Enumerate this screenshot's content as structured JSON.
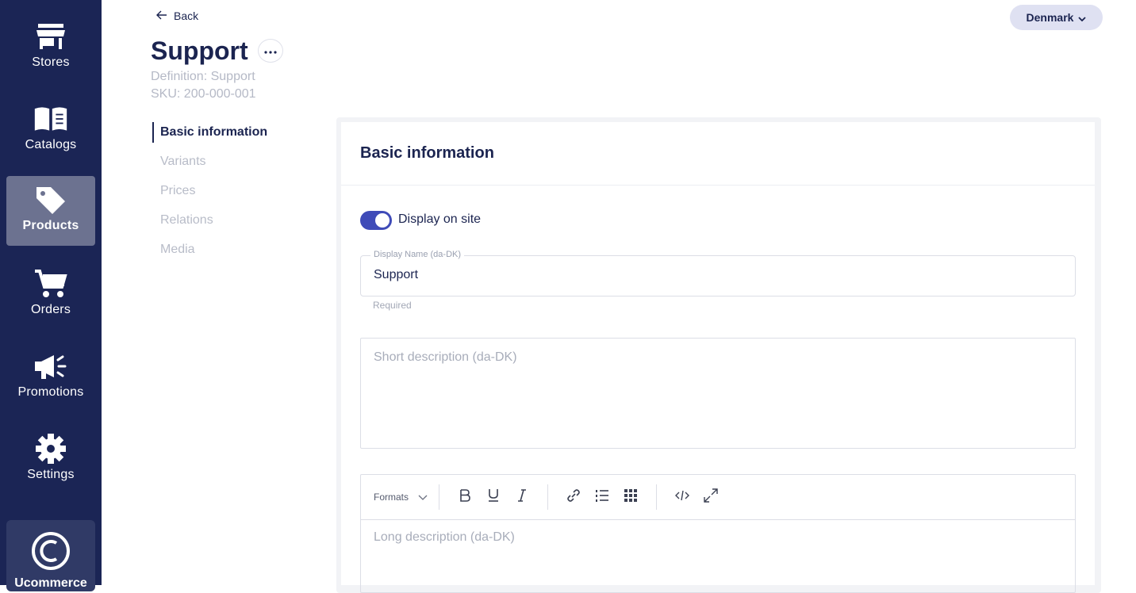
{
  "sidebar": {
    "items": [
      {
        "label": "Stores"
      },
      {
        "label": "Catalogs"
      },
      {
        "label": "Products"
      },
      {
        "label": "Orders"
      },
      {
        "label": "Promotions"
      },
      {
        "label": "Settings"
      }
    ],
    "brand": "Ucommerce"
  },
  "header": {
    "back_label": "Back",
    "title": "Support",
    "definition": "Definition: Support",
    "sku": "SKU: 200-000-001",
    "country": "Denmark"
  },
  "section_nav": [
    "Basic information",
    "Variants",
    "Prices",
    "Relations",
    "Media"
  ],
  "card": {
    "title": "Basic information",
    "toggle_label": "Display on site",
    "display_name_label": "Display Name (da-DK)",
    "display_name_value": "Support",
    "display_name_helper": "Required",
    "short_desc_placeholder": "Short description (da-DK)",
    "formats_label": "Formats",
    "long_desc_placeholder": "Long description (da-DK)"
  },
  "colors": {
    "sidebar": "#1b2555",
    "accent": "#3f4bb8",
    "text": "#1b2450"
  }
}
